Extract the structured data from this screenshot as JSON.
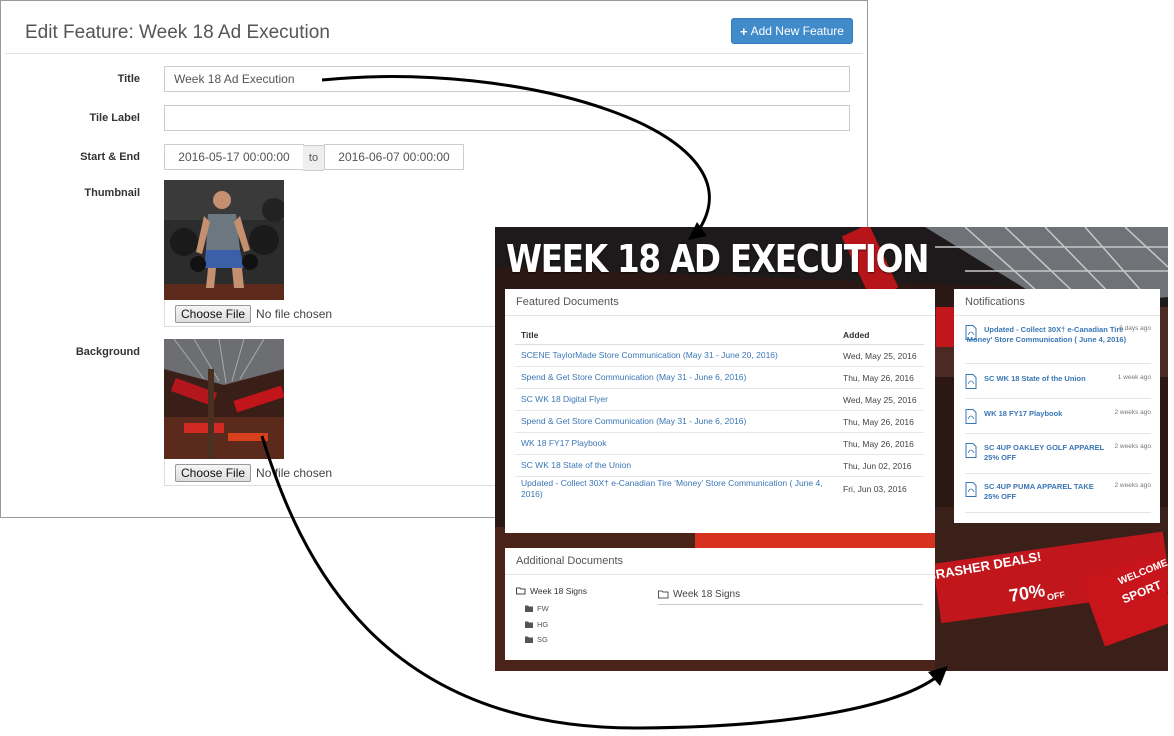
{
  "edit": {
    "title": "Edit Feature: Week 18 Ad Execution",
    "add_button": "Add New Feature",
    "fields": {
      "title_label": "Title",
      "title_value": "Week 18 Ad Execution",
      "tile_label_label": "Tile Label",
      "tile_label_value": "",
      "start_end_label": "Start & End",
      "start_value": "2016-05-17 00:00:00",
      "to_text": "to",
      "end_value": "2016-06-07 00:00:00",
      "thumbnail_label": "Thumbnail",
      "background_label": "Background",
      "choose_file": "Choose File",
      "no_file": "No file chosen"
    }
  },
  "feature": {
    "heading": "WEEK 18 AD EXECUTION",
    "featured_docs_title": "Featured Documents",
    "columns": [
      "Title",
      "Added"
    ],
    "documents": [
      {
        "title": "SCENE TaylorMade Store Communication (May 31 - June 20, 2016)",
        "added": "Wed, May 25, 2016"
      },
      {
        "title": "Spend & Get Store Communication (May 31 - June 6, 2016)",
        "added": "Thu, May 26, 2016"
      },
      {
        "title": "SC WK 18 Digital Flyer",
        "added": "Wed, May 25, 2016"
      },
      {
        "title": "Spend & Get Store Communication (May 31 - June 6, 2016)",
        "added": "Thu, May 26, 2016"
      },
      {
        "title": "WK 18 FY17 Playbook",
        "added": "Thu, May 26, 2016"
      },
      {
        "title": "SC WK 18 State of the Union",
        "added": "Thu, Jun 02, 2016"
      },
      {
        "title": "Updated - Collect 30X† e-Canadian Tire ‘Money’ Store Communication ( June 4, 2016)",
        "added": "Fri, Jun 03, 2016"
      }
    ],
    "notifications_title": "Notifications",
    "notifications": [
      {
        "text": "Updated - Collect 30X† e-Canadian Tire 'Money' Store Communication ( June 4, 2016)",
        "time": "6 days ago"
      },
      {
        "text": "SC WK 18 State of the Union",
        "time": "1 week ago"
      },
      {
        "text": "WK 18 FY17 Playbook",
        "time": "2 weeks ago"
      },
      {
        "text": "SC 4UP OAKLEY GOLF APPAREL 25% OFF",
        "time": "2 weeks ago"
      },
      {
        "text": "SC 4UP PUMA APPAREL TAKE 25% OFF",
        "time": "2 weeks ago"
      }
    ],
    "additional_docs_title": "Additional Documents",
    "folder_root": "Week 18 Signs",
    "subfolders": [
      "FW",
      "HG",
      "SG"
    ],
    "breadcrumb": "Week 18 Signs",
    "bg_signs": [
      "DOORCRASHER DEALS!",
      "70%",
      "OFF",
      "WELCOME",
      "SPORT"
    ]
  },
  "colors": {
    "primary": "#428bca",
    "link": "#3a76b5",
    "arrow": "#000000"
  }
}
